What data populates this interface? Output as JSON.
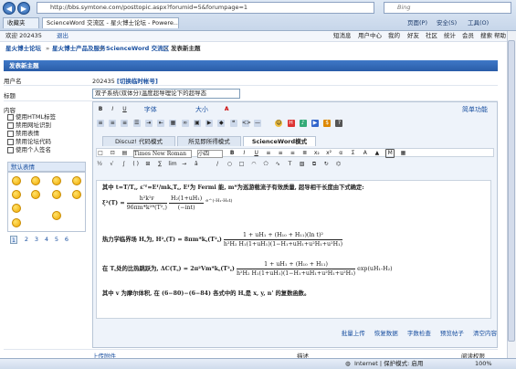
{
  "browser": {
    "url": "http://bbs.symtone.com/posttopic.aspx?forumid=5&forumpage=1",
    "search_placeholder": "Bing",
    "tabs": [
      "收藏夹",
      "ScienceWord 交流区 - 星火博士论坛 - Powere..."
    ],
    "commands": [
      "页面(P)",
      "安全(S)",
      "工具(O)"
    ],
    "status_text": "Internet | 保护模式: 启用",
    "zoom": "100%"
  },
  "forum": {
    "userbar": {
      "user": "欢迎 202435",
      "logout": "退出",
      "links": [
        "短消息",
        "用户中心",
        "我的",
        "好友",
        "社区",
        "统计",
        "会员",
        "搜索",
        "帮助"
      ]
    },
    "breadcrumb": [
      "星火博士论坛",
      "星火博士产品及服务",
      "ScienceWord 交流区",
      "发表新主题"
    ],
    "panel_title": "发表新主题",
    "username_label": "用户名",
    "username_value": "202435",
    "username_action": "[切换临时帐号]",
    "title_label": "标题",
    "title_value": "双子系统(双体分)温度超导理论下的超导态",
    "content_label": "内容",
    "options": [
      "使用HTML标签",
      "禁用网址识别",
      "禁用表情",
      "禁用论坛代码",
      "使用个人签名"
    ],
    "smilies_tab": "默认表情",
    "pages": [
      "1",
      "2",
      "3",
      "4",
      "5",
      "6"
    ]
  },
  "editor": {
    "font_label": "字体",
    "size_label": "大小",
    "simple_label": "简单功能",
    "mode_tabs": [
      "Discuz! 代码模式",
      "所见即所得模式",
      "ScienceWord模式"
    ],
    "font_select": "Times New Roman",
    "size_select": "小四",
    "content": {
      "p1": "其中 t=T/T꜀, ε'ᶠ=Eᶠ/mk꜀T꜀, Eᶠ为 Fermi 能, m*为巡游载流子有效质量, 超导相干长度由下式确定:",
      "f1_lhs": "ξ²(T) =",
      "f1_num": "h²k²ꜰ",
      "f1_den": "96πm*k²ᴮ(T²꜀)",
      "f1_mid_num": "H₂(1+uH₁)",
      "f1_mid_den": "(−int)",
      "f1_tail": "e^(-H₁-H₂t)",
      "p2": "热力学临界场 H꜀为,",
      "f2_lhs": "H²꜀(T) = 8πm*k꜀(T²꜀)",
      "f2_num": "1 + uH₁ + (H₁₀ + H₁₁)(ln t)²",
      "f2_den": "h²H₂ H₁(1+uH₁)(1−H₁+uH₁+u²H₁+u²H₁)",
      "p3_lhs": "在 T꜀处的比热跳跃为,  ΔC(T꜀) = 2π²Vm*k꜀(T²꜀)",
      "f3_num": "1 + uH₁ + (H₁₀ + H₁₁)",
      "f3_den": "h²H₂ H₁(1+uH₁)(1−H₁+uH₁+u²H₁+u²H₁)",
      "f3_tail": "exp(uH₁-H₂)",
      "p4": "其中 v 为摩尔体积, 在 (6−80)−(6−84) 各式中的 H꜀是 x, y, n' 的复数函数。"
    },
    "bottom_links": [
      "批量上传",
      "恢复数据",
      "字数检查",
      "预览帖子",
      "清空内容"
    ]
  },
  "footer": {
    "attach": "上传附件",
    "desc": "描述",
    "readperm": "阅读权限"
  }
}
